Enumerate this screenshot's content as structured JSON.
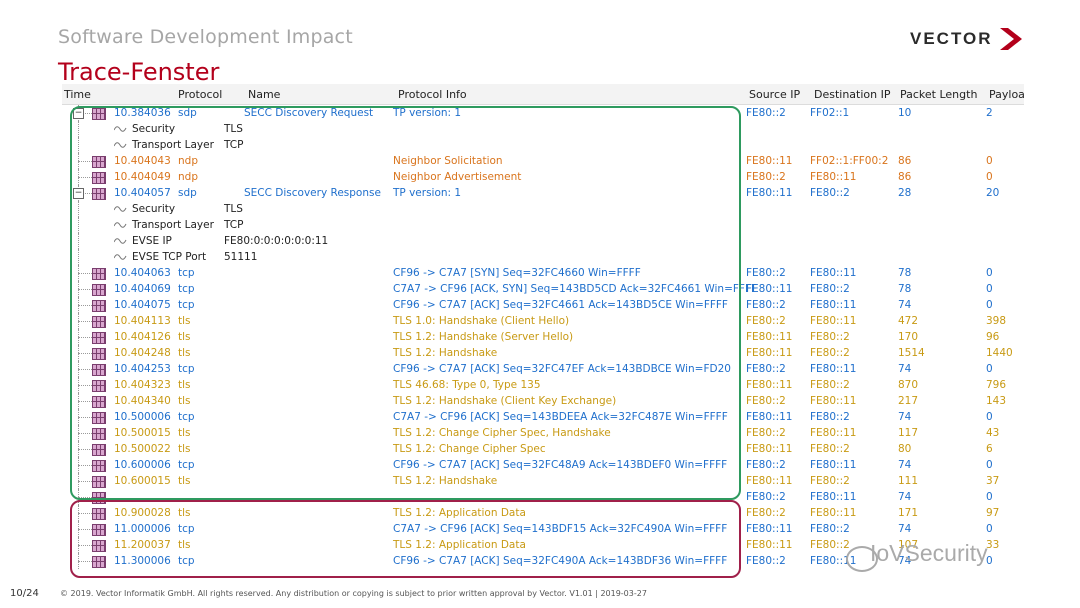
{
  "header": {
    "subtitle": "Software Development Impact",
    "title": "Trace-Fenster",
    "logo": "VECTOR"
  },
  "table": {
    "columns": [
      "Time",
      "Protocol",
      "Name",
      "Protocol Info",
      "Source IP",
      "Destination IP",
      "Packet Length",
      "Payloa"
    ]
  },
  "rows": [
    {
      "type": "pkt",
      "expand": "minus",
      "time": "10.384036",
      "proto": "sdp",
      "name": "SECC Discovery Request",
      "info": "TP version: 1",
      "src": "FE80::2",
      "dst": "FF02::1",
      "len": "10",
      "pay": "2",
      "color": "blue"
    },
    {
      "type": "sub",
      "label": "Security",
      "val": "TLS"
    },
    {
      "type": "sub",
      "label": "Transport Layer",
      "val": "TCP"
    },
    {
      "type": "pkt",
      "time": "10.404043",
      "proto": "ndp",
      "name": "",
      "info": "Neighbor Solicitation",
      "src": "FE80::11",
      "dst": "FF02::1:FF00:2",
      "len": "86",
      "pay": "0",
      "color": "orange"
    },
    {
      "type": "pkt",
      "time": "10.404049",
      "proto": "ndp",
      "name": "",
      "info": "Neighbor Advertisement",
      "src": "FE80::2",
      "dst": "FE80::11",
      "len": "86",
      "pay": "0",
      "color": "orange"
    },
    {
      "type": "pkt",
      "expand": "minus",
      "time": "10.404057",
      "proto": "sdp",
      "name": "SECC Discovery Response",
      "info": "TP version: 1",
      "src": "FE80::11",
      "dst": "FE80::2",
      "len": "28",
      "pay": "20",
      "color": "blue"
    },
    {
      "type": "sub",
      "label": "Security",
      "val": "TLS"
    },
    {
      "type": "sub",
      "label": "Transport Layer",
      "val": "TCP"
    },
    {
      "type": "sub",
      "label": "EVSE IP",
      "val": "FE80:0:0:0:0:0:0:11"
    },
    {
      "type": "sub",
      "label": "EVSE TCP Port",
      "val": "51111"
    },
    {
      "type": "pkt",
      "time": "10.404063",
      "proto": "tcp",
      "name": "",
      "info": "CF96 -> C7A7 [SYN] Seq=32FC4660 Win=FFFF",
      "src": "FE80::2",
      "dst": "FE80::11",
      "len": "78",
      "pay": "0",
      "color": "blue"
    },
    {
      "type": "pkt",
      "time": "10.404069",
      "proto": "tcp",
      "name": "",
      "info": "C7A7 -> CF96 [ACK, SYN] Seq=143BD5CD Ack=32FC4661 Win=FFFF",
      "src": "FE80::11",
      "dst": "FE80::2",
      "len": "78",
      "pay": "0",
      "color": "blue"
    },
    {
      "type": "pkt",
      "time": "10.404075",
      "proto": "tcp",
      "name": "",
      "info": "CF96 -> C7A7 [ACK] Seq=32FC4661 Ack=143BD5CE Win=FFFF",
      "src": "FE80::2",
      "dst": "FE80::11",
      "len": "74",
      "pay": "0",
      "color": "blue"
    },
    {
      "type": "pkt",
      "time": "10.404113",
      "proto": "tls",
      "name": "",
      "info": "TLS 1.0: Handshake (Client Hello)",
      "src": "FE80::2",
      "dst": "FE80::11",
      "len": "472",
      "pay": "398",
      "color": "gold"
    },
    {
      "type": "pkt",
      "time": "10.404126",
      "proto": "tls",
      "name": "",
      "info": "TLS 1.2: Handshake (Server Hello)",
      "src": "FE80::11",
      "dst": "FE80::2",
      "len": "170",
      "pay": "96",
      "color": "gold"
    },
    {
      "type": "pkt",
      "time": "10.404248",
      "proto": "tls",
      "name": "",
      "info": "TLS 1.2: Handshake",
      "src": "FE80::11",
      "dst": "FE80::2",
      "len": "1514",
      "pay": "1440",
      "color": "gold"
    },
    {
      "type": "pkt",
      "time": "10.404253",
      "proto": "tcp",
      "name": "",
      "info": "CF96 -> C7A7 [ACK] Seq=32FC47EF Ack=143BDBCE Win=FD20",
      "src": "FE80::2",
      "dst": "FE80::11",
      "len": "74",
      "pay": "0",
      "color": "blue"
    },
    {
      "type": "pkt",
      "time": "10.404323",
      "proto": "tls",
      "name": "",
      "info": "TLS 46.68: Type 0, Type 135",
      "src": "FE80::11",
      "dst": "FE80::2",
      "len": "870",
      "pay": "796",
      "color": "gold"
    },
    {
      "type": "pkt",
      "time": "10.404340",
      "proto": "tls",
      "name": "",
      "info": "TLS 1.2: Handshake (Client Key Exchange)",
      "src": "FE80::2",
      "dst": "FE80::11",
      "len": "217",
      "pay": "143",
      "color": "gold"
    },
    {
      "type": "pkt",
      "time": "10.500006",
      "proto": "tcp",
      "name": "",
      "info": "C7A7 -> CF96 [ACK] Seq=143BDEEA Ack=32FC487E Win=FFFF",
      "src": "FE80::11",
      "dst": "FE80::2",
      "len": "74",
      "pay": "0",
      "color": "blue"
    },
    {
      "type": "pkt",
      "time": "10.500015",
      "proto": "tls",
      "name": "",
      "info": "TLS 1.2: Change Cipher Spec, Handshake",
      "src": "FE80::2",
      "dst": "FE80::11",
      "len": "117",
      "pay": "43",
      "color": "gold"
    },
    {
      "type": "pkt",
      "time": "10.500022",
      "proto": "tls",
      "name": "",
      "info": "TLS 1.2: Change Cipher Spec",
      "src": "FE80::11",
      "dst": "FE80::2",
      "len": "80",
      "pay": "6",
      "color": "gold"
    },
    {
      "type": "pkt",
      "time": "10.600006",
      "proto": "tcp",
      "name": "",
      "info": "CF96 -> C7A7 [ACK] Seq=32FC48A9 Ack=143BDEF0 Win=FFFF",
      "src": "FE80::2",
      "dst": "FE80::11",
      "len": "74",
      "pay": "0",
      "color": "blue"
    },
    {
      "type": "pkt",
      "time": "10.600015",
      "proto": "tls",
      "name": "",
      "info": "TLS 1.2: Handshake",
      "src": "FE80::11",
      "dst": "FE80::2",
      "len": "111",
      "pay": "37",
      "color": "gold"
    },
    {
      "type": "pkt",
      "time": "",
      "proto": "",
      "name": "",
      "info": "",
      "src": "FE80::2",
      "dst": "FE80::11",
      "len": "74",
      "pay": "0",
      "color": "blue"
    },
    {
      "type": "pkt",
      "time": "10.900028",
      "proto": "tls",
      "name": "",
      "info": "TLS 1.2: Application Data",
      "src": "FE80::2",
      "dst": "FE80::11",
      "len": "171",
      "pay": "97",
      "color": "gold"
    },
    {
      "type": "pkt",
      "time": "11.000006",
      "proto": "tcp",
      "name": "",
      "info": "C7A7 -> CF96 [ACK] Seq=143BDF15 Ack=32FC490A Win=FFFF",
      "src": "FE80::11",
      "dst": "FE80::2",
      "len": "74",
      "pay": "0",
      "color": "blue"
    },
    {
      "type": "pkt",
      "time": "11.200037",
      "proto": "tls",
      "name": "",
      "info": "TLS 1.2: Application Data",
      "src": "FE80::11",
      "dst": "FE80::2",
      "len": "107",
      "pay": "33",
      "color": "gold"
    },
    {
      "type": "pkt",
      "time": "11.300006",
      "proto": "tcp",
      "name": "",
      "info": "CF96 -> C7A7 [ACK] Seq=32FC490A Ack=143BDF36 Win=FFFF",
      "src": "FE80::2",
      "dst": "FE80::11",
      "len": "74",
      "pay": "0",
      "color": "blue"
    }
  ],
  "footer": {
    "page": "10/24",
    "copyright": "© 2019. Vector Informatik GmbH. All rights reserved. Any distribution or copying is subject to prior written approval by Vector. V1.01 | 2019-03-27"
  },
  "watermark": "IoVSecurity",
  "colors": {
    "accent_red": "#b3001b",
    "green_box": "#2e9a5f",
    "red_box": "#a0204a",
    "blue": "#1f6fcc",
    "orange": "#d9741c",
    "gold": "#c89a14"
  }
}
